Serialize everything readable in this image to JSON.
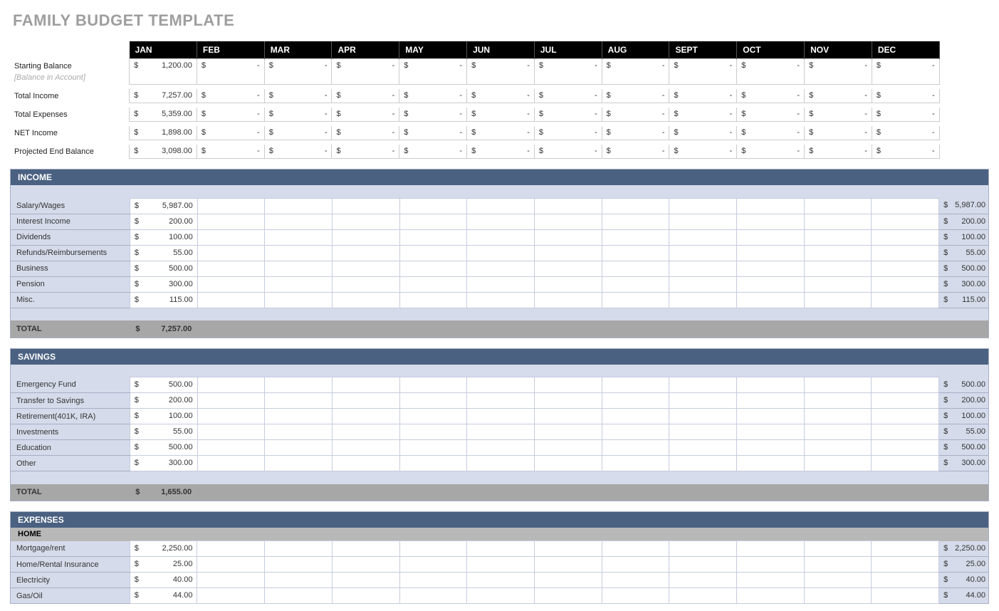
{
  "title": "FAMILY BUDGET TEMPLATE",
  "months": [
    "JAN",
    "FEB",
    "MAR",
    "APR",
    "MAY",
    "JUN",
    "JUL",
    "AUG",
    "SEPT",
    "OCT",
    "NOV",
    "DEC"
  ],
  "summary_rows": [
    {
      "label": "Starting Balance",
      "sublabel": "[Balance in Account]",
      "jan": "1,200.00"
    },
    {
      "label": "Total Income",
      "sublabel": "",
      "jan": "7,257.00"
    },
    {
      "label": "Total Expenses",
      "sublabel": "",
      "jan": "5,359.00"
    },
    {
      "label": "NET Income",
      "sublabel": "",
      "jan": "1,898.00"
    },
    {
      "label": "Projected End Balance",
      "sublabel": "",
      "jan": "3,098.00"
    }
  ],
  "sections": [
    {
      "name": "INCOME",
      "rows": [
        {
          "label": "Salary/Wages",
          "jan": "5,987.00",
          "tot": "5,987.00"
        },
        {
          "label": "Interest Income",
          "jan": "200.00",
          "tot": "200.00"
        },
        {
          "label": "Dividends",
          "jan": "100.00",
          "tot": "100.00"
        },
        {
          "label": "Refunds/Reimbursements",
          "jan": "55.00",
          "tot": "55.00"
        },
        {
          "label": "Business",
          "jan": "500.00",
          "tot": "500.00"
        },
        {
          "label": "Pension",
          "jan": "300.00",
          "tot": "300.00"
        },
        {
          "label": "Misc.",
          "jan": "115.00",
          "tot": "115.00"
        }
      ],
      "total_label": "TOTAL",
      "total_jan": "7,257.00"
    },
    {
      "name": "SAVINGS",
      "rows": [
        {
          "label": "Emergency Fund",
          "jan": "500.00",
          "tot": "500.00"
        },
        {
          "label": "Transfer to Savings",
          "jan": "200.00",
          "tot": "200.00"
        },
        {
          "label": "Retirement(401K, IRA)",
          "jan": "100.00",
          "tot": "100.00"
        },
        {
          "label": "Investments",
          "jan": "55.00",
          "tot": "55.00"
        },
        {
          "label": "Education",
          "jan": "500.00",
          "tot": "500.00"
        },
        {
          "label": "Other",
          "jan": "300.00",
          "tot": "300.00"
        }
      ],
      "total_label": "TOTAL",
      "total_jan": "1,655.00"
    },
    {
      "name": "EXPENSES",
      "subname": "HOME",
      "rows": [
        {
          "label": "Mortgage/rent",
          "jan": "2,250.00",
          "tot": "2,250.00"
        },
        {
          "label": "Home/Rental Insurance",
          "jan": "25.00",
          "tot": "25.00"
        },
        {
          "label": "Electricity",
          "jan": "40.00",
          "tot": "40.00"
        },
        {
          "label": "Gas/Oil",
          "jan": "44.00",
          "tot": "44.00"
        }
      ],
      "total_label": "",
      "total_jan": ""
    }
  ]
}
